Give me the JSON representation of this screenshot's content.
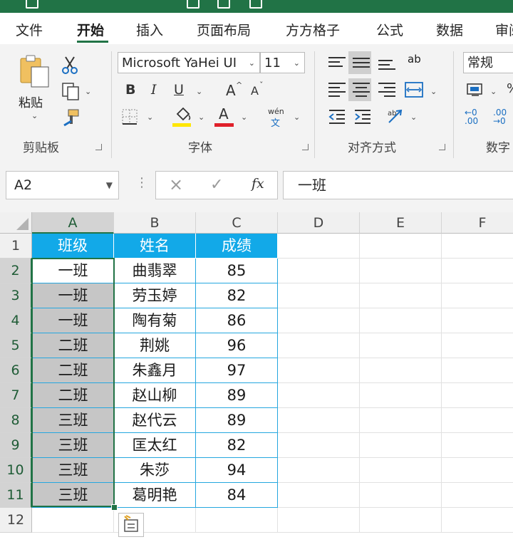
{
  "ribbon_tabs": [
    "文件",
    "开始",
    "插入",
    "页面布局",
    "方方格子",
    "公式",
    "数据",
    "审阅"
  ],
  "active_tab": "开始",
  "clipboard": {
    "paste_label": "粘贴",
    "group_label": "剪贴板"
  },
  "font": {
    "name": "Microsoft YaHei UI",
    "size": "11",
    "bold": "B",
    "italic": "I",
    "underline": "U",
    "grow": "A",
    "shrink": "A",
    "phonetic_top": "wén",
    "phonetic_bottom": "文",
    "font_color_letter": "A",
    "group_label": "字体"
  },
  "alignment": {
    "group_label": "对齐方式",
    "wrap_label": "ab"
  },
  "number": {
    "format": "常规",
    "group_label": "数字",
    "dec_increase": "←0 .00",
    "dec_decrease": ".00 →0"
  },
  "formula_bar": {
    "name_box": "A2",
    "cancel": "×",
    "enter": "✓",
    "fx": "fx",
    "content": "一班"
  },
  "sheet": {
    "columns": [
      "A",
      "B",
      "C",
      "D",
      "E",
      "F"
    ],
    "rows": [
      "1",
      "2",
      "3",
      "4",
      "5",
      "6",
      "7",
      "8",
      "9",
      "10",
      "11",
      "12"
    ],
    "header": [
      "班级",
      "姓名",
      "成绩"
    ],
    "data": [
      [
        "一班",
        "曲翡翠",
        "85"
      ],
      [
        "一班",
        "劳玉婷",
        "82"
      ],
      [
        "一班",
        "陶有菊",
        "86"
      ],
      [
        "二班",
        "荆姚",
        "96"
      ],
      [
        "二班",
        "朱鑫月",
        "97"
      ],
      [
        "二班",
        "赵山柳",
        "89"
      ],
      [
        "三班",
        "赵代云",
        "89"
      ],
      [
        "三班",
        "匡太红",
        "82"
      ],
      [
        "三班",
        "朱莎",
        "94"
      ],
      [
        "三班",
        "葛明艳",
        "84"
      ]
    ]
  },
  "colors": {
    "accent": "#217346",
    "table_header": "#12a9e8",
    "font_color_bar": "#e0202a",
    "highlight_bar": "#ffe600"
  }
}
